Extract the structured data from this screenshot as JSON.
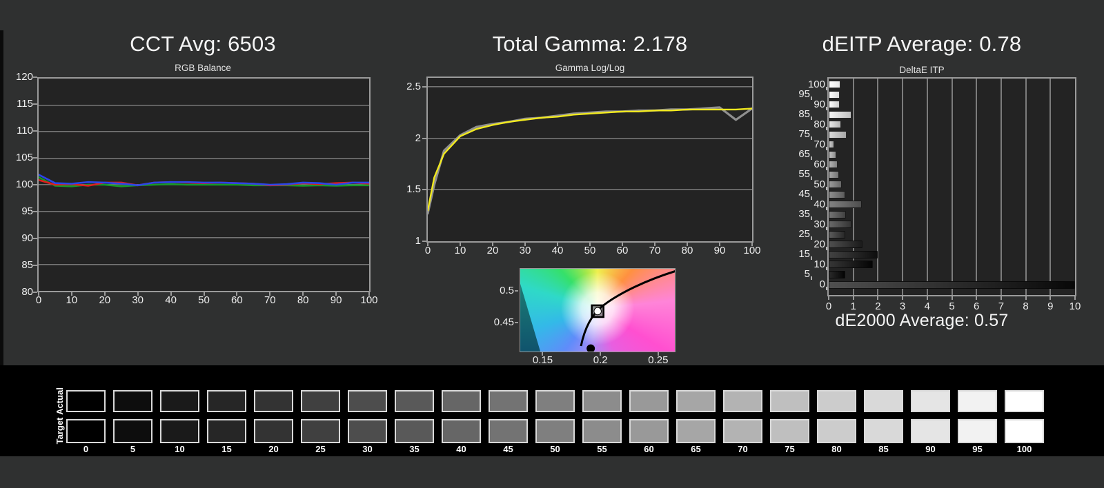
{
  "colors": {
    "background": "#2f3030",
    "plot_background": "#232323",
    "plot_border": "#9b9b9b",
    "gridline": "#6a6a6a",
    "text": "#f4f4f4",
    "red_series": "#df1d1d",
    "green_series": "#169a28",
    "blue_series": "#2b46e8",
    "target_yellow": "#f2ea1f",
    "measured_gray": "#8f8f8f"
  },
  "chart_data": [
    {
      "id": "rgb_balance",
      "type": "line",
      "title": "CCT Avg: 6503",
      "subtitle": "RGB Balance",
      "xlim": [
        0,
        100
      ],
      "ylim": [
        80,
        120
      ],
      "x_ticks": [
        0,
        10,
        20,
        30,
        40,
        50,
        60,
        70,
        80,
        90,
        100
      ],
      "y_ticks": [
        80,
        85,
        90,
        95,
        100,
        105,
        110,
        115,
        120
      ],
      "grid": true,
      "x": [
        0,
        5,
        10,
        15,
        20,
        25,
        30,
        35,
        40,
        45,
        50,
        55,
        60,
        65,
        70,
        75,
        80,
        85,
        90,
        95,
        100
      ],
      "series": [
        {
          "name": "red",
          "color": "#df1d1d",
          "values": [
            100.9,
            100.0,
            100.1,
            99.8,
            100.4,
            100.4,
            99.9,
            100.4,
            100.5,
            100.4,
            100.3,
            100.4,
            100.3,
            100.2,
            99.9,
            100.0,
            100.3,
            100.1,
            100.3,
            100.4,
            100.2
          ]
        },
        {
          "name": "green",
          "color": "#169a28",
          "values": [
            101.4,
            99.8,
            99.7,
            100.0,
            100.0,
            99.7,
            99.9,
            100.0,
            100.1,
            100.0,
            100.0,
            100.0,
            100.0,
            99.9,
            99.9,
            99.9,
            99.8,
            99.9,
            99.8,
            99.9,
            99.9
          ]
        },
        {
          "name": "blue",
          "color": "#2b46e8",
          "values": [
            101.9,
            100.3,
            100.2,
            100.5,
            100.4,
            100.2,
            99.9,
            100.4,
            100.5,
            100.5,
            100.4,
            100.4,
            100.3,
            100.2,
            100.0,
            100.1,
            100.4,
            100.3,
            100.0,
            100.4,
            100.4
          ]
        }
      ]
    },
    {
      "id": "gamma",
      "type": "line",
      "title": "Total Gamma: 2.178",
      "subtitle": "Gamma Log/Log",
      "xlim": [
        0,
        100
      ],
      "ylim": [
        1,
        2.5
      ],
      "x_ticks": [
        0,
        10,
        20,
        30,
        40,
        50,
        60,
        70,
        80,
        90,
        100
      ],
      "y_ticks": [
        1,
        1.5,
        2,
        2.5
      ],
      "grid": true,
      "x": [
        0,
        2,
        5,
        10,
        15,
        20,
        25,
        30,
        35,
        40,
        45,
        50,
        55,
        60,
        65,
        70,
        75,
        80,
        85,
        90,
        95,
        100
      ],
      "series": [
        {
          "name": "measured",
          "color": "#8f8f8f",
          "values": [
            1.27,
            1.55,
            1.88,
            2.03,
            2.11,
            2.14,
            2.16,
            2.19,
            2.2,
            2.22,
            2.24,
            2.25,
            2.26,
            2.26,
            2.27,
            2.27,
            2.28,
            2.28,
            2.29,
            2.3,
            2.18,
            2.29
          ]
        },
        {
          "name": "target",
          "color": "#f2ea1f",
          "values": [
            1.3,
            1.62,
            1.85,
            2.02,
            2.09,
            2.13,
            2.16,
            2.18,
            2.2,
            2.21,
            2.23,
            2.24,
            2.25,
            2.26,
            2.26,
            2.27,
            2.27,
            2.28,
            2.28,
            2.28,
            2.28,
            2.29
          ]
        }
      ]
    },
    {
      "id": "cie_chromaticity",
      "type": "scatter",
      "xlim": [
        0.13,
        0.265
      ],
      "ylim": [
        0.403,
        0.536
      ],
      "x_ticks": [
        "0.15",
        "0.2",
        "0.25"
      ],
      "y_ticks": [
        "0.5",
        "0.45"
      ],
      "white_point": {
        "u": 0.197,
        "v": 0.469
      },
      "measured_dot": {
        "u": 0.191,
        "v": 0.41
      }
    },
    {
      "id": "deitp",
      "type": "bar",
      "title": "dEITP Average: 0.78",
      "subtitle": "DeltaE ITP",
      "footer": "dE2000 Average: 0.57",
      "xlim": [
        0,
        10
      ],
      "x_ticks": [
        0,
        1,
        2,
        3,
        4,
        5,
        6,
        7,
        8,
        9,
        10
      ],
      "levels": [
        100,
        95,
        90,
        85,
        80,
        75,
        70,
        65,
        60,
        55,
        50,
        45,
        40,
        35,
        30,
        25,
        20,
        15,
        10,
        5,
        0
      ],
      "values": [
        0.48,
        0.46,
        0.44,
        0.91,
        0.49,
        0.72,
        0.21,
        0.32,
        0.37,
        0.42,
        0.53,
        0.66,
        1.34,
        0.69,
        0.91,
        0.68,
        1.38,
        2.0,
        1.8,
        0.68,
        10
      ]
    }
  ],
  "grayscale_strip": {
    "row_labels": [
      "Actual",
      "Target"
    ],
    "levels": [
      0,
      5,
      10,
      15,
      20,
      25,
      30,
      35,
      40,
      45,
      50,
      55,
      60,
      65,
      70,
      75,
      80,
      85,
      90,
      95,
      100
    ]
  }
}
